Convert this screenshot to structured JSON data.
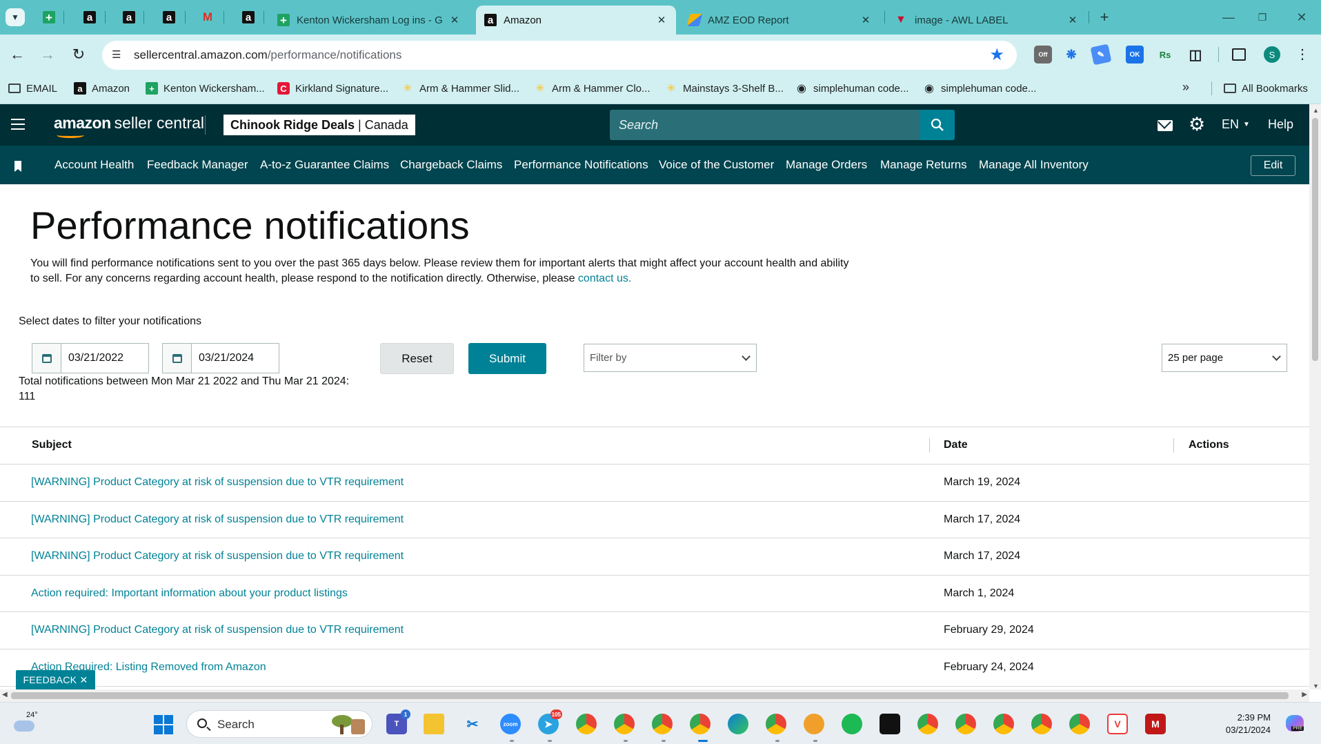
{
  "browser": {
    "tabs": [
      {
        "title": "Kenton Wickersham Log ins - G",
        "icon": "sheets-icon",
        "active": false
      },
      {
        "title": "Amazon",
        "icon": "amazon-icon",
        "active": true
      },
      {
        "title": "AMZ EOD Report",
        "icon": "report-icon",
        "active": false
      },
      {
        "title": "image - AWL LABEL",
        "icon": "awl-icon",
        "active": false
      }
    ],
    "close_glyph": "✕",
    "new_tab_glyph": "+",
    "url_host": "sellercentral.amazon.com",
    "url_path": "/performance/notifications",
    "bookmarks": [
      {
        "label": "EMAIL"
      },
      {
        "label": "Amazon"
      },
      {
        "label": "Kenton Wickersham..."
      },
      {
        "label": "Kirkland Signature..."
      },
      {
        "label": "Arm & Hammer Slid..."
      },
      {
        "label": "Arm & Hammer Clo..."
      },
      {
        "label": "Mainstays 3-Shelf B..."
      },
      {
        "label": "simplehuman code..."
      },
      {
        "label": "simplehuman code..."
      }
    ],
    "more_bookmarks_glyph": "»",
    "all_bookmarks": "All Bookmarks",
    "profile_initial": "S",
    "extension_off_label": "Off",
    "extension_ok_label": "OK",
    "extension_rs_label": "Rs"
  },
  "header": {
    "logo_bold": "amazon",
    "logo_rest": "seller central",
    "store_name": "Chinook Ridge Deals",
    "store_separator": "|",
    "store_region": "Canada",
    "search_placeholder": "Search",
    "language": "EN",
    "help": "Help"
  },
  "nav": {
    "links": [
      "Account Health",
      "Feedback Manager",
      "A-to-z Guarantee Claims",
      "Chargeback Claims",
      "Performance Notifications",
      "Voice of the Customer",
      "Manage Orders",
      "Manage Returns",
      "Manage All Inventory"
    ],
    "edit_label": "Edit"
  },
  "page": {
    "title": "Performance notifications",
    "intro_text": "You will find performance notifications sent to you over the past 365 days below. Please review them for important alerts that might affect your account health and ability to sell. For any concerns regarding account health, please respond to the notification directly. Otherwise, please ",
    "intro_link": "contact us.",
    "filter_label": "Select dates to filter your notifications",
    "start_date": "03/21/2022",
    "end_date": "03/21/2024",
    "reset_label": "Reset",
    "submit_label": "Submit",
    "filter_by_label": "Filter by",
    "per_page_label": "25 per page",
    "total_text": "Total notifications between Mon Mar 21 2022 and Thu Mar 21 2024:",
    "total_count": "111"
  },
  "table": {
    "headers": {
      "subject": "Subject",
      "date": "Date",
      "actions": "Actions"
    },
    "rows": [
      {
        "subject": "[WARNING] Product Category at risk of suspension due to VTR requirement",
        "date": "March 19, 2024"
      },
      {
        "subject": "[WARNING] Product Category at risk of suspension due to VTR requirement",
        "date": "March 17, 2024"
      },
      {
        "subject": "[WARNING] Product Category at risk of suspension due to VTR requirement",
        "date": "March 17, 2024"
      },
      {
        "subject": "Action required: Important information about your product listings",
        "date": "March 1, 2024"
      },
      {
        "subject": "[WARNING] Product Category at risk of suspension due to VTR requirement",
        "date": "February 29, 2024"
      },
      {
        "subject": "Action Required: Listing Removed from Amazon",
        "date": "February 24, 2024"
      }
    ]
  },
  "feedback": {
    "label": "FEEDBACK ✕"
  },
  "taskbar": {
    "weather_temp": "24°",
    "search_label": "Search",
    "time": "2:39 PM",
    "date": "03/21/2024",
    "teams_badge": "1",
    "telegram_badge": "105",
    "zoom_label": "zoom",
    "copilot_badge": "PRE"
  },
  "colors": {
    "chrome_tabstrip": "#5bc3c7",
    "chrome_toolbar": "#d2f0f1",
    "header_bg": "#002f36",
    "nav_bg": "#00454f",
    "accent_teal": "#008296"
  }
}
